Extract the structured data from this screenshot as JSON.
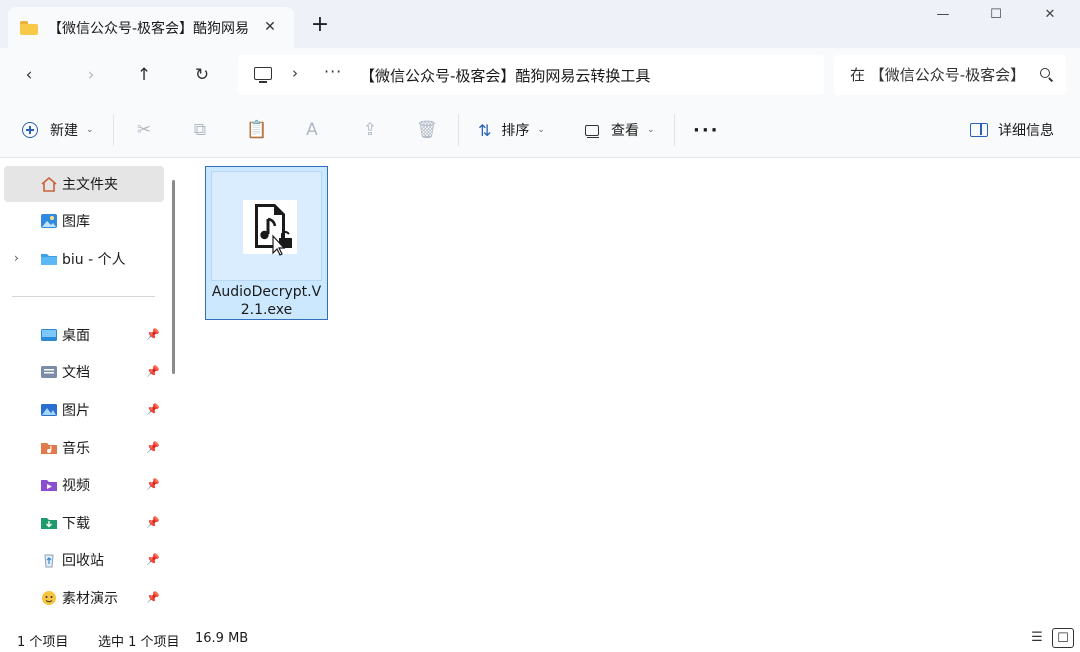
{
  "window": {
    "tab_title": "【微信公众号-极客会】酷狗网易云转换工具",
    "new_tab_glyph": "+",
    "close_tab_glyph": "✕",
    "minimize_glyph": "—",
    "maximize_glyph": "☐",
    "close_glyph": "✕"
  },
  "nav": {
    "back_glyph": "‹",
    "forward_glyph": "›",
    "up_glyph": "↑",
    "refresh_glyph": "↻"
  },
  "address": {
    "separator": "›",
    "more": "···",
    "path": "【微信公众号-极客会】酷狗网易云转换工具"
  },
  "search": {
    "placeholder": "在 【微信公众号-极客会】酷狗网易云转换工具 中搜索"
  },
  "toolbar": {
    "new_label": "新建",
    "sort_label": "排序",
    "view_label": "查看",
    "more_glyph": "···",
    "details_label": "详细信息",
    "chevron": "⌄",
    "cut_glyph": "✂",
    "copy_glyph": "⧉",
    "paste_glyph": "📋",
    "rename_glyph": "A",
    "share_glyph": "⇪",
    "delete_glyph": "🗑"
  },
  "sidebar": {
    "items": [
      {
        "label": "主文件夹",
        "icon": "home-icon"
      },
      {
        "label": "图库",
        "icon": "gallery-icon"
      },
      {
        "label": "biu - 个人",
        "icon": "onedrive-folder-icon"
      },
      {
        "label": "桌面",
        "icon": "desktop-icon",
        "pinned": true
      },
      {
        "label": "文档",
        "icon": "documents-icon",
        "pinned": true
      },
      {
        "label": "图片",
        "icon": "pictures-icon",
        "pinned": true
      },
      {
        "label": "音乐",
        "icon": "music-icon",
        "pinned": true
      },
      {
        "label": "视频",
        "icon": "videos-icon",
        "pinned": true
      },
      {
        "label": "下载",
        "icon": "downloads-icon",
        "pinned": true
      },
      {
        "label": "回收站",
        "icon": "recycle-bin-icon",
        "pinned": true
      },
      {
        "label": "素材演示",
        "icon": "custom-folder-icon",
        "pinned": true
      }
    ],
    "expand_glyph": "›",
    "pin_glyph": "📌"
  },
  "content": {
    "files": [
      {
        "name": "AudioDecrypt.V2.1.exe",
        "icon": "audio-file-icon",
        "selected": true
      }
    ]
  },
  "status": {
    "item_count": "1 个项目",
    "selection": "选中 1 个项目",
    "size": "16.9 MB"
  },
  "colors": {
    "accent": "#2a62b8",
    "selection_fill": "#cce8ff",
    "selection_border": "#2f6fbd",
    "titlebar_bg": "#eef2f8"
  }
}
